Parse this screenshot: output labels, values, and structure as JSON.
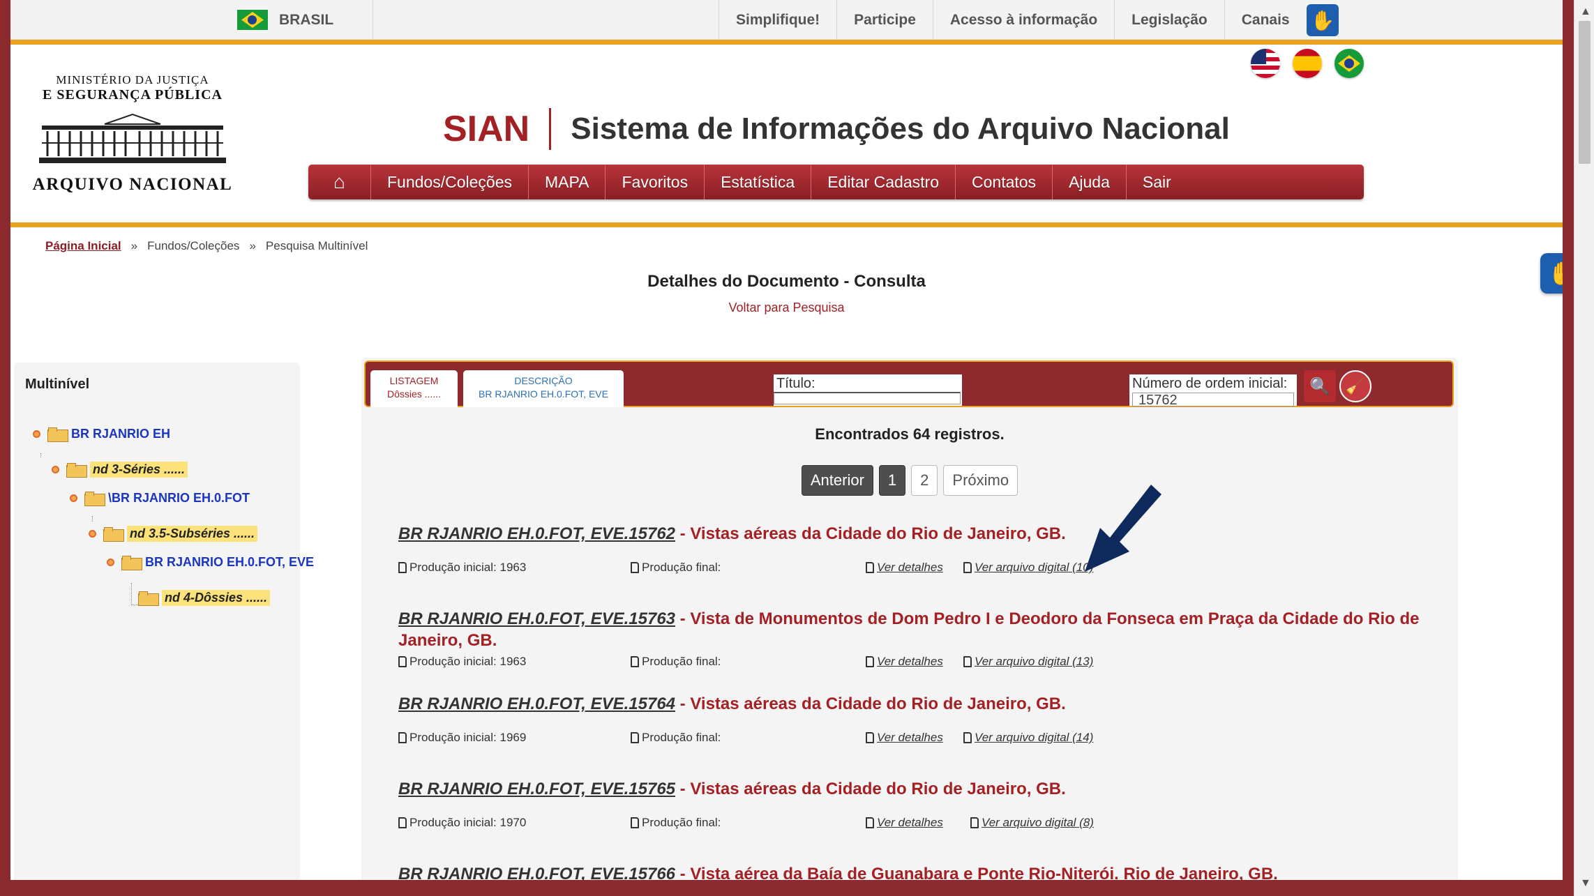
{
  "govbar": {
    "country": "BRASIL",
    "links": [
      "Simplifique!",
      "Participe",
      "Acesso à informação",
      "Legislação",
      "Canais"
    ]
  },
  "logo": {
    "line1": "MINISTÉRIO DA JUSTIÇA",
    "line2": "E SEGURANÇA PÚBLICA",
    "name": "ARQUIVO NACIONAL"
  },
  "header": {
    "acronym": "SIAN",
    "title": "Sistema de Informações do Arquivo Nacional"
  },
  "nav": {
    "items": [
      "Fundos/Coleções",
      "MAPA",
      "Favoritos",
      "Estatística",
      "Editar Cadastro",
      "Contatos",
      "Ajuda",
      "Sair"
    ]
  },
  "breadcrumb": {
    "home": "Página Inicial",
    "sep": "»",
    "items": [
      "Fundos/Coleções",
      "Pesquisa Multinível"
    ]
  },
  "page": {
    "title": "Detalhes do Documento - Consulta",
    "back": "Voltar para Pesquisa"
  },
  "sidebar": {
    "title": "Multinível",
    "nodes": [
      {
        "label": "BR RJANRIO EH",
        "type": "link"
      },
      {
        "label": "nd 3-Séries ......",
        "type": "level"
      },
      {
        "label": "\\BR RJANRIO EH.0.FOT",
        "type": "link"
      },
      {
        "label": "nd 3.5-Subséries ......",
        "type": "level"
      },
      {
        "label": "BR RJANRIO EH.0.FOT, EVE",
        "type": "link"
      },
      {
        "label": "nd 4-Dôssies ......",
        "type": "level"
      }
    ]
  },
  "tabs": {
    "listagem": {
      "line1": "LISTAGEM",
      "line2": "Dôssies ......"
    },
    "descricao": {
      "line1": "DESCRIÇÃO",
      "line2": "BR RJANRIO EH.0.FOT, EVE"
    }
  },
  "search": {
    "titulo_label": "Título:",
    "titulo_value": "",
    "ordem_label": "Número de ordem inicial:",
    "ordem_value": "15762"
  },
  "results": {
    "count": "Encontrados 64 registros.",
    "pager": {
      "prev": "Anterior",
      "pages": [
        "1",
        "2"
      ],
      "next": "Próximo",
      "current": "1"
    },
    "labels": {
      "prod_ini": "Produção inicial:",
      "prod_fin": "Produção final:",
      "details": "Ver detalhes"
    },
    "records": [
      {
        "code": "BR RJANRIO EH.0.FOT, EVE.15762",
        "title": "Vistas aéreas da Cidade do Rio de Janeiro, GB.",
        "prod_ini": "1963",
        "prod_fin": "",
        "digital": "Ver arquivo digital (10)"
      },
      {
        "code": "BR RJANRIO EH.0.FOT, EVE.15763",
        "title": "Vista de Monumentos de Dom Pedro I e Deodoro da Fonseca em Praça da Cidade do Rio de Janeiro, GB.",
        "prod_ini": "1963",
        "prod_fin": "",
        "digital": "Ver arquivo digital (13)"
      },
      {
        "code": "BR RJANRIO EH.0.FOT, EVE.15764",
        "title": "Vistas aéreas da Cidade do Rio de Janeiro, GB.",
        "prod_ini": "1969",
        "prod_fin": "",
        "digital": "Ver arquivo digital (14)"
      },
      {
        "code": "BR RJANRIO EH.0.FOT, EVE.15765",
        "title": "Vistas aéreas da Cidade do Rio de Janeiro, GB.",
        "prod_ini": "1970",
        "prod_fin": "",
        "digital": "Ver arquivo digital (8)"
      },
      {
        "code": "BR RJANRIO EH.0.FOT, EVE.15766",
        "title": "Vista aérea da Baía de Guanabara e Ponte Rio-Niterói. Rio de Janeiro, GB.",
        "prod_ini": "",
        "prod_fin": "",
        "digital": ""
      }
    ]
  },
  "colors": {
    "brand_red": "#a32125",
    "frame": "#8b2a2e",
    "gold": "#e8a21f",
    "link_blue": "#1a35c2",
    "arrow": "#0e2a5c"
  },
  "icons": {
    "home": "home-icon",
    "search": "search-icon",
    "clear": "broom-icon",
    "vlibras": "sign-language-hand-icon",
    "document": "document-icon"
  }
}
